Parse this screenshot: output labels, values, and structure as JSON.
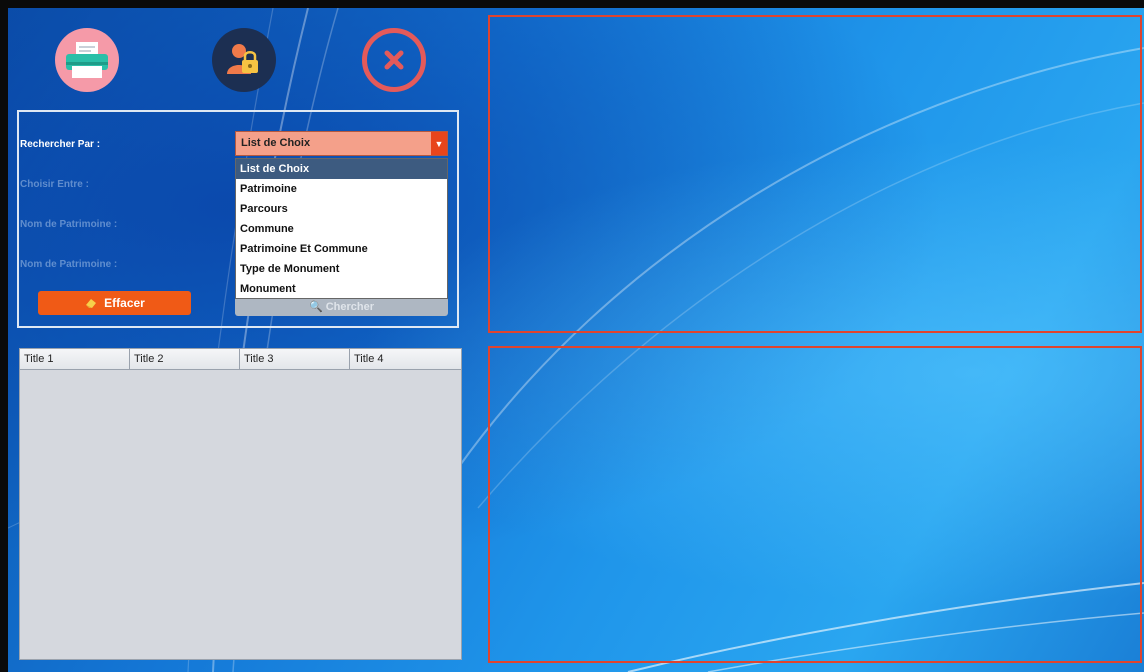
{
  "toolbar": {
    "printer_icon": "printer-icon",
    "lock_icon": "user-lock-icon",
    "close_icon": "close-icon"
  },
  "search_form": {
    "search_by_label": "Rechercher Par :",
    "choose_between_label": "Choisir Entre :",
    "heritage_name_label_1": "Nom de Patrimoine :",
    "heritage_name_label_2": "Nom de Patrimoine :",
    "combo_selected": "List de Choix",
    "dropdown_options": [
      "List de Choix",
      "Patrimoine",
      "Parcours",
      "Commune",
      "Patrimoine Et Commune",
      "Type de Monument",
      "Monument"
    ],
    "clear_button": "Effacer",
    "search_button": "Chercher"
  },
  "table": {
    "columns": [
      "Title 1",
      "Title 2",
      "Title 3",
      "Title 4"
    ]
  },
  "colors": {
    "accent_orange": "#f05a16",
    "frame_red": "#e0442e",
    "selection_blue": "#3d5b80"
  }
}
